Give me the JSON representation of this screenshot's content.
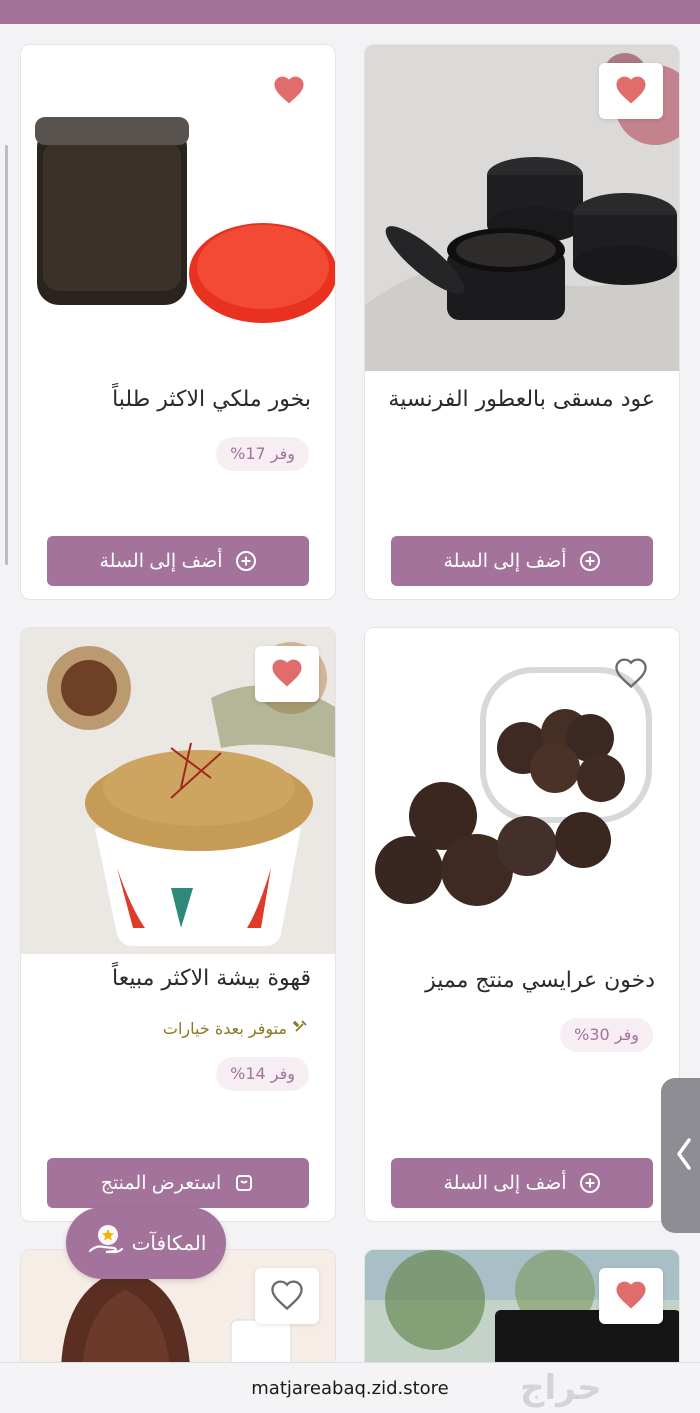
{
  "colors": {
    "accent": "#a3739b",
    "heart_filled": "#e06c6c",
    "badge_bg": "#f7eef3",
    "options_text": "#8a7a20"
  },
  "products": [
    {
      "title": "عود مسقى بالعطور الفرنسية",
      "favorited": true,
      "button": "أضف إلى السلة",
      "button_icon": "plus-circle-icon"
    },
    {
      "title": "بخور ملكي الاكثر طلباً",
      "favorited": true,
      "discount": "وفر 17%",
      "button": "أضف إلى السلة",
      "button_icon": "plus-circle-icon"
    },
    {
      "title": "دخون عرايسي منتج مميز",
      "favorited": false,
      "discount": "وفر 30%",
      "button": "أضف إلى السلة",
      "button_icon": "plus-circle-icon"
    },
    {
      "title": "قهوة بيشة الاكثر مبيعاً",
      "favorited": true,
      "options": "متوفر بعدة خيارات",
      "discount": "وفر 14%",
      "button": "استعرض المنتج",
      "button_icon": "view-product-icon"
    },
    {
      "favorited": true
    },
    {
      "favorited": false
    }
  ],
  "rewards": {
    "label": "المكافآت"
  },
  "side_tab": {
    "icon": "chevron-left-icon"
  },
  "browser": {
    "url": "matjareabaq.zid.store"
  },
  "watermark": {
    "text": "حراج"
  }
}
